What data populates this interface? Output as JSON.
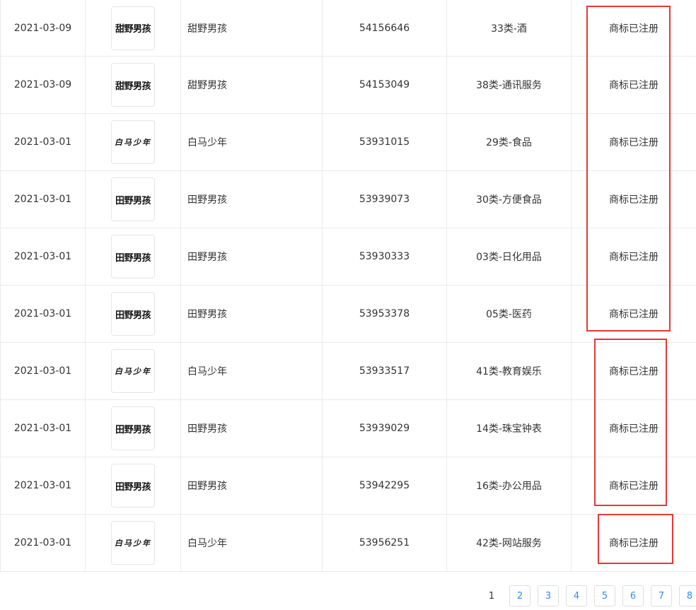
{
  "rows": [
    {
      "date": "2021-03-09",
      "logo": "甜野男孩",
      "logo_style": "serif",
      "name": "甜野男孩",
      "reg_no": "54156646",
      "class": "33类-酒",
      "status": "商标已注册"
    },
    {
      "date": "2021-03-09",
      "logo": "甜野男孩",
      "logo_style": "serif",
      "name": "甜野男孩",
      "reg_no": "54153049",
      "class": "38类-通讯服务",
      "status": "商标已注册"
    },
    {
      "date": "2021-03-01",
      "logo": "白马少年",
      "logo_style": "script",
      "name": "白马少年",
      "reg_no": "53931015",
      "class": "29类-食品",
      "status": "商标已注册"
    },
    {
      "date": "2021-03-01",
      "logo": "田野男孩",
      "logo_style": "serif",
      "name": "田野男孩",
      "reg_no": "53939073",
      "class": "30类-方便食品",
      "status": "商标已注册"
    },
    {
      "date": "2021-03-01",
      "logo": "田野男孩",
      "logo_style": "serif",
      "name": "田野男孩",
      "reg_no": "53930333",
      "class": "03类-日化用品",
      "status": "商标已注册"
    },
    {
      "date": "2021-03-01",
      "logo": "田野男孩",
      "logo_style": "serif",
      "name": "田野男孩",
      "reg_no": "53953378",
      "class": "05类-医药",
      "status": "商标已注册"
    },
    {
      "date": "2021-03-01",
      "logo": "白马少年",
      "logo_style": "script",
      "name": "白马少年",
      "reg_no": "53933517",
      "class": "41类-教育娱乐",
      "status": "商标已注册"
    },
    {
      "date": "2021-03-01",
      "logo": "田野男孩",
      "logo_style": "serif",
      "name": "田野男孩",
      "reg_no": "53939029",
      "class": "14类-珠宝钟表",
      "status": "商标已注册"
    },
    {
      "date": "2021-03-01",
      "logo": "田野男孩",
      "logo_style": "serif",
      "name": "田野男孩",
      "reg_no": "53942295",
      "class": "16类-办公用品",
      "status": "商标已注册"
    },
    {
      "date": "2021-03-01",
      "logo": "白马少年",
      "logo_style": "script",
      "name": "白马少年",
      "reg_no": "53956251",
      "class": "42类-网站服务",
      "status": "商标已注册"
    }
  ],
  "pagination": {
    "current": "1",
    "pages": [
      "1",
      "2",
      "3",
      "4",
      "5",
      "6",
      "7",
      "8"
    ]
  },
  "colors": {
    "highlight_border": "#e53935",
    "page_link": "#2d8cf0",
    "grid_line": "#e8eaec"
  }
}
